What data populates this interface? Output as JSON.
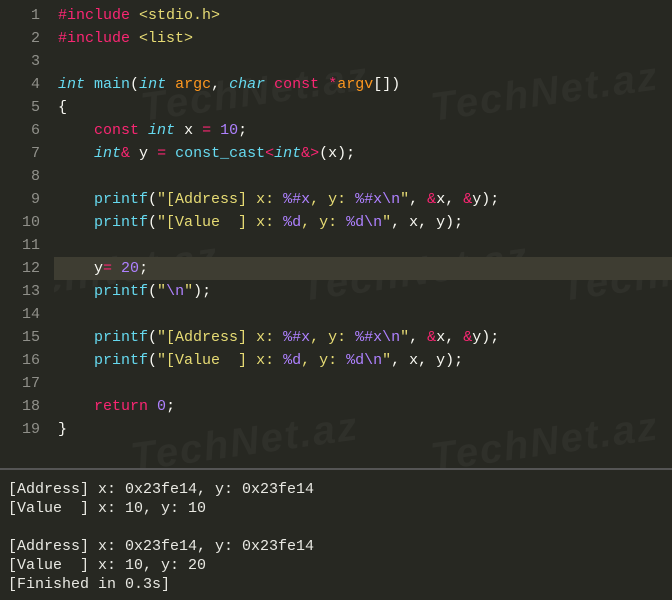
{
  "code_lines": [
    {
      "n": 1,
      "raw": "#include <stdio.h>",
      "tokens": [
        [
          "tok-preproc",
          "#"
        ],
        [
          "tok-preproc-kw",
          "include"
        ],
        [
          "tok-plain",
          " "
        ],
        [
          "tok-string",
          "<stdio.h>"
        ]
      ]
    },
    {
      "n": 2,
      "raw": "#include <list>",
      "tokens": [
        [
          "tok-preproc",
          "#"
        ],
        [
          "tok-preproc-kw",
          "include"
        ],
        [
          "tok-plain",
          " "
        ],
        [
          "tok-string",
          "<list>"
        ]
      ]
    },
    {
      "n": 3,
      "raw": "",
      "tokens": []
    },
    {
      "n": 4,
      "raw": "int main(int argc, char const *argv[])",
      "tokens": [
        [
          "tok-type",
          "int"
        ],
        [
          "tok-plain",
          " "
        ],
        [
          "tok-func",
          "main"
        ],
        [
          "tok-plain",
          "("
        ],
        [
          "tok-type",
          "int"
        ],
        [
          "tok-plain",
          " "
        ],
        [
          "tok-arg",
          "argc"
        ],
        [
          "tok-plain",
          ", "
        ],
        [
          "tok-type",
          "char"
        ],
        [
          "tok-plain",
          " "
        ],
        [
          "tok-keyword",
          "const"
        ],
        [
          "tok-plain",
          " "
        ],
        [
          "tok-op",
          "*"
        ],
        [
          "tok-arg",
          "argv"
        ],
        [
          "tok-plain",
          "[])"
        ]
      ]
    },
    {
      "n": 5,
      "raw": "{",
      "tokens": [
        [
          "tok-plain",
          "{"
        ]
      ]
    },
    {
      "n": 6,
      "raw": "    const int x = 10;",
      "tokens": [
        [
          "tok-plain",
          "    "
        ],
        [
          "tok-keyword",
          "const"
        ],
        [
          "tok-plain",
          " "
        ],
        [
          "tok-type",
          "int"
        ],
        [
          "tok-plain",
          " x "
        ],
        [
          "tok-op",
          "="
        ],
        [
          "tok-plain",
          " "
        ],
        [
          "tok-num",
          "10"
        ],
        [
          "tok-plain",
          ";"
        ]
      ]
    },
    {
      "n": 7,
      "raw": "    int& y = const_cast<int&>(x);",
      "tokens": [
        [
          "tok-plain",
          "    "
        ],
        [
          "tok-type",
          "int"
        ],
        [
          "tok-op",
          "&"
        ],
        [
          "tok-plain",
          " y "
        ],
        [
          "tok-op",
          "="
        ],
        [
          "tok-plain",
          " "
        ],
        [
          "tok-cast",
          "const_cast"
        ],
        [
          "tok-op",
          "<"
        ],
        [
          "tok-type",
          "int"
        ],
        [
          "tok-op",
          "&>"
        ],
        [
          "tok-plain",
          "(x);"
        ]
      ]
    },
    {
      "n": 8,
      "raw": "",
      "tokens": []
    },
    {
      "n": 9,
      "raw": "    printf(\"[Address] x: %#x, y: %#x\\n\", &x, &y);",
      "tokens": [
        [
          "tok-plain",
          "    "
        ],
        [
          "tok-func",
          "printf"
        ],
        [
          "tok-plain",
          "("
        ],
        [
          "tok-string",
          "\"[Address] x: "
        ],
        [
          "tok-esc",
          "%#x"
        ],
        [
          "tok-string",
          ", y: "
        ],
        [
          "tok-esc",
          "%#x"
        ],
        [
          "tok-esc",
          "\\n"
        ],
        [
          "tok-string",
          "\""
        ],
        [
          "tok-plain",
          ", "
        ],
        [
          "tok-op",
          "&"
        ],
        [
          "tok-plain",
          "x, "
        ],
        [
          "tok-op",
          "&"
        ],
        [
          "tok-plain",
          "y);"
        ]
      ]
    },
    {
      "n": 10,
      "raw": "    printf(\"[Value  ] x: %d, y: %d\\n\", x, y);",
      "tokens": [
        [
          "tok-plain",
          "    "
        ],
        [
          "tok-func",
          "printf"
        ],
        [
          "tok-plain",
          "("
        ],
        [
          "tok-string",
          "\"[Value  ] x: "
        ],
        [
          "tok-esc",
          "%d"
        ],
        [
          "tok-string",
          ", y: "
        ],
        [
          "tok-esc",
          "%d"
        ],
        [
          "tok-esc",
          "\\n"
        ],
        [
          "tok-string",
          "\""
        ],
        [
          "tok-plain",
          ", x, y);"
        ]
      ]
    },
    {
      "n": 11,
      "raw": "",
      "tokens": []
    },
    {
      "n": 12,
      "raw": "    y= 20;",
      "hl": true,
      "tokens": [
        [
          "tok-plain",
          "    y"
        ],
        [
          "tok-op",
          "="
        ],
        [
          "tok-plain",
          " "
        ],
        [
          "tok-num",
          "20"
        ],
        [
          "tok-plain",
          ";"
        ]
      ]
    },
    {
      "n": 13,
      "raw": "    printf(\"\\n\");",
      "tokens": [
        [
          "tok-plain",
          "    "
        ],
        [
          "tok-func",
          "printf"
        ],
        [
          "tok-plain",
          "("
        ],
        [
          "tok-string",
          "\""
        ],
        [
          "tok-esc",
          "\\n"
        ],
        [
          "tok-string",
          "\""
        ],
        [
          "tok-plain",
          ");"
        ]
      ]
    },
    {
      "n": 14,
      "raw": "",
      "tokens": []
    },
    {
      "n": 15,
      "raw": "    printf(\"[Address] x: %#x, y: %#x\\n\", &x, &y);",
      "tokens": [
        [
          "tok-plain",
          "    "
        ],
        [
          "tok-func",
          "printf"
        ],
        [
          "tok-plain",
          "("
        ],
        [
          "tok-string",
          "\"[Address] x: "
        ],
        [
          "tok-esc",
          "%#x"
        ],
        [
          "tok-string",
          ", y: "
        ],
        [
          "tok-esc",
          "%#x"
        ],
        [
          "tok-esc",
          "\\n"
        ],
        [
          "tok-string",
          "\""
        ],
        [
          "tok-plain",
          ", "
        ],
        [
          "tok-op",
          "&"
        ],
        [
          "tok-plain",
          "x, "
        ],
        [
          "tok-op",
          "&"
        ],
        [
          "tok-plain",
          "y);"
        ]
      ]
    },
    {
      "n": 16,
      "raw": "    printf(\"[Value  ] x: %d, y: %d\\n\", x, y);",
      "tokens": [
        [
          "tok-plain",
          "    "
        ],
        [
          "tok-func",
          "printf"
        ],
        [
          "tok-plain",
          "("
        ],
        [
          "tok-string",
          "\"[Value  ] x: "
        ],
        [
          "tok-esc",
          "%d"
        ],
        [
          "tok-string",
          ", y: "
        ],
        [
          "tok-esc",
          "%d"
        ],
        [
          "tok-esc",
          "\\n"
        ],
        [
          "tok-string",
          "\""
        ],
        [
          "tok-plain",
          ", x, y);"
        ]
      ]
    },
    {
      "n": 17,
      "raw": "",
      "tokens": []
    },
    {
      "n": 18,
      "raw": "    return 0;",
      "tokens": [
        [
          "tok-plain",
          "    "
        ],
        [
          "tok-keyword",
          "return"
        ],
        [
          "tok-plain",
          " "
        ],
        [
          "tok-num",
          "0"
        ],
        [
          "tok-plain",
          ";"
        ]
      ]
    },
    {
      "n": 19,
      "raw": "}",
      "tokens": [
        [
          "tok-plain",
          "}"
        ]
      ]
    }
  ],
  "output_lines": [
    "[Address] x: 0x23fe14, y: 0x23fe14",
    "[Value  ] x: 10, y: 10",
    "",
    "[Address] x: 0x23fe14, y: 0x23fe14",
    "[Value  ] x: 10, y: 20",
    "[Finished in 0.3s]"
  ],
  "watermark_text": "TechNet.az"
}
